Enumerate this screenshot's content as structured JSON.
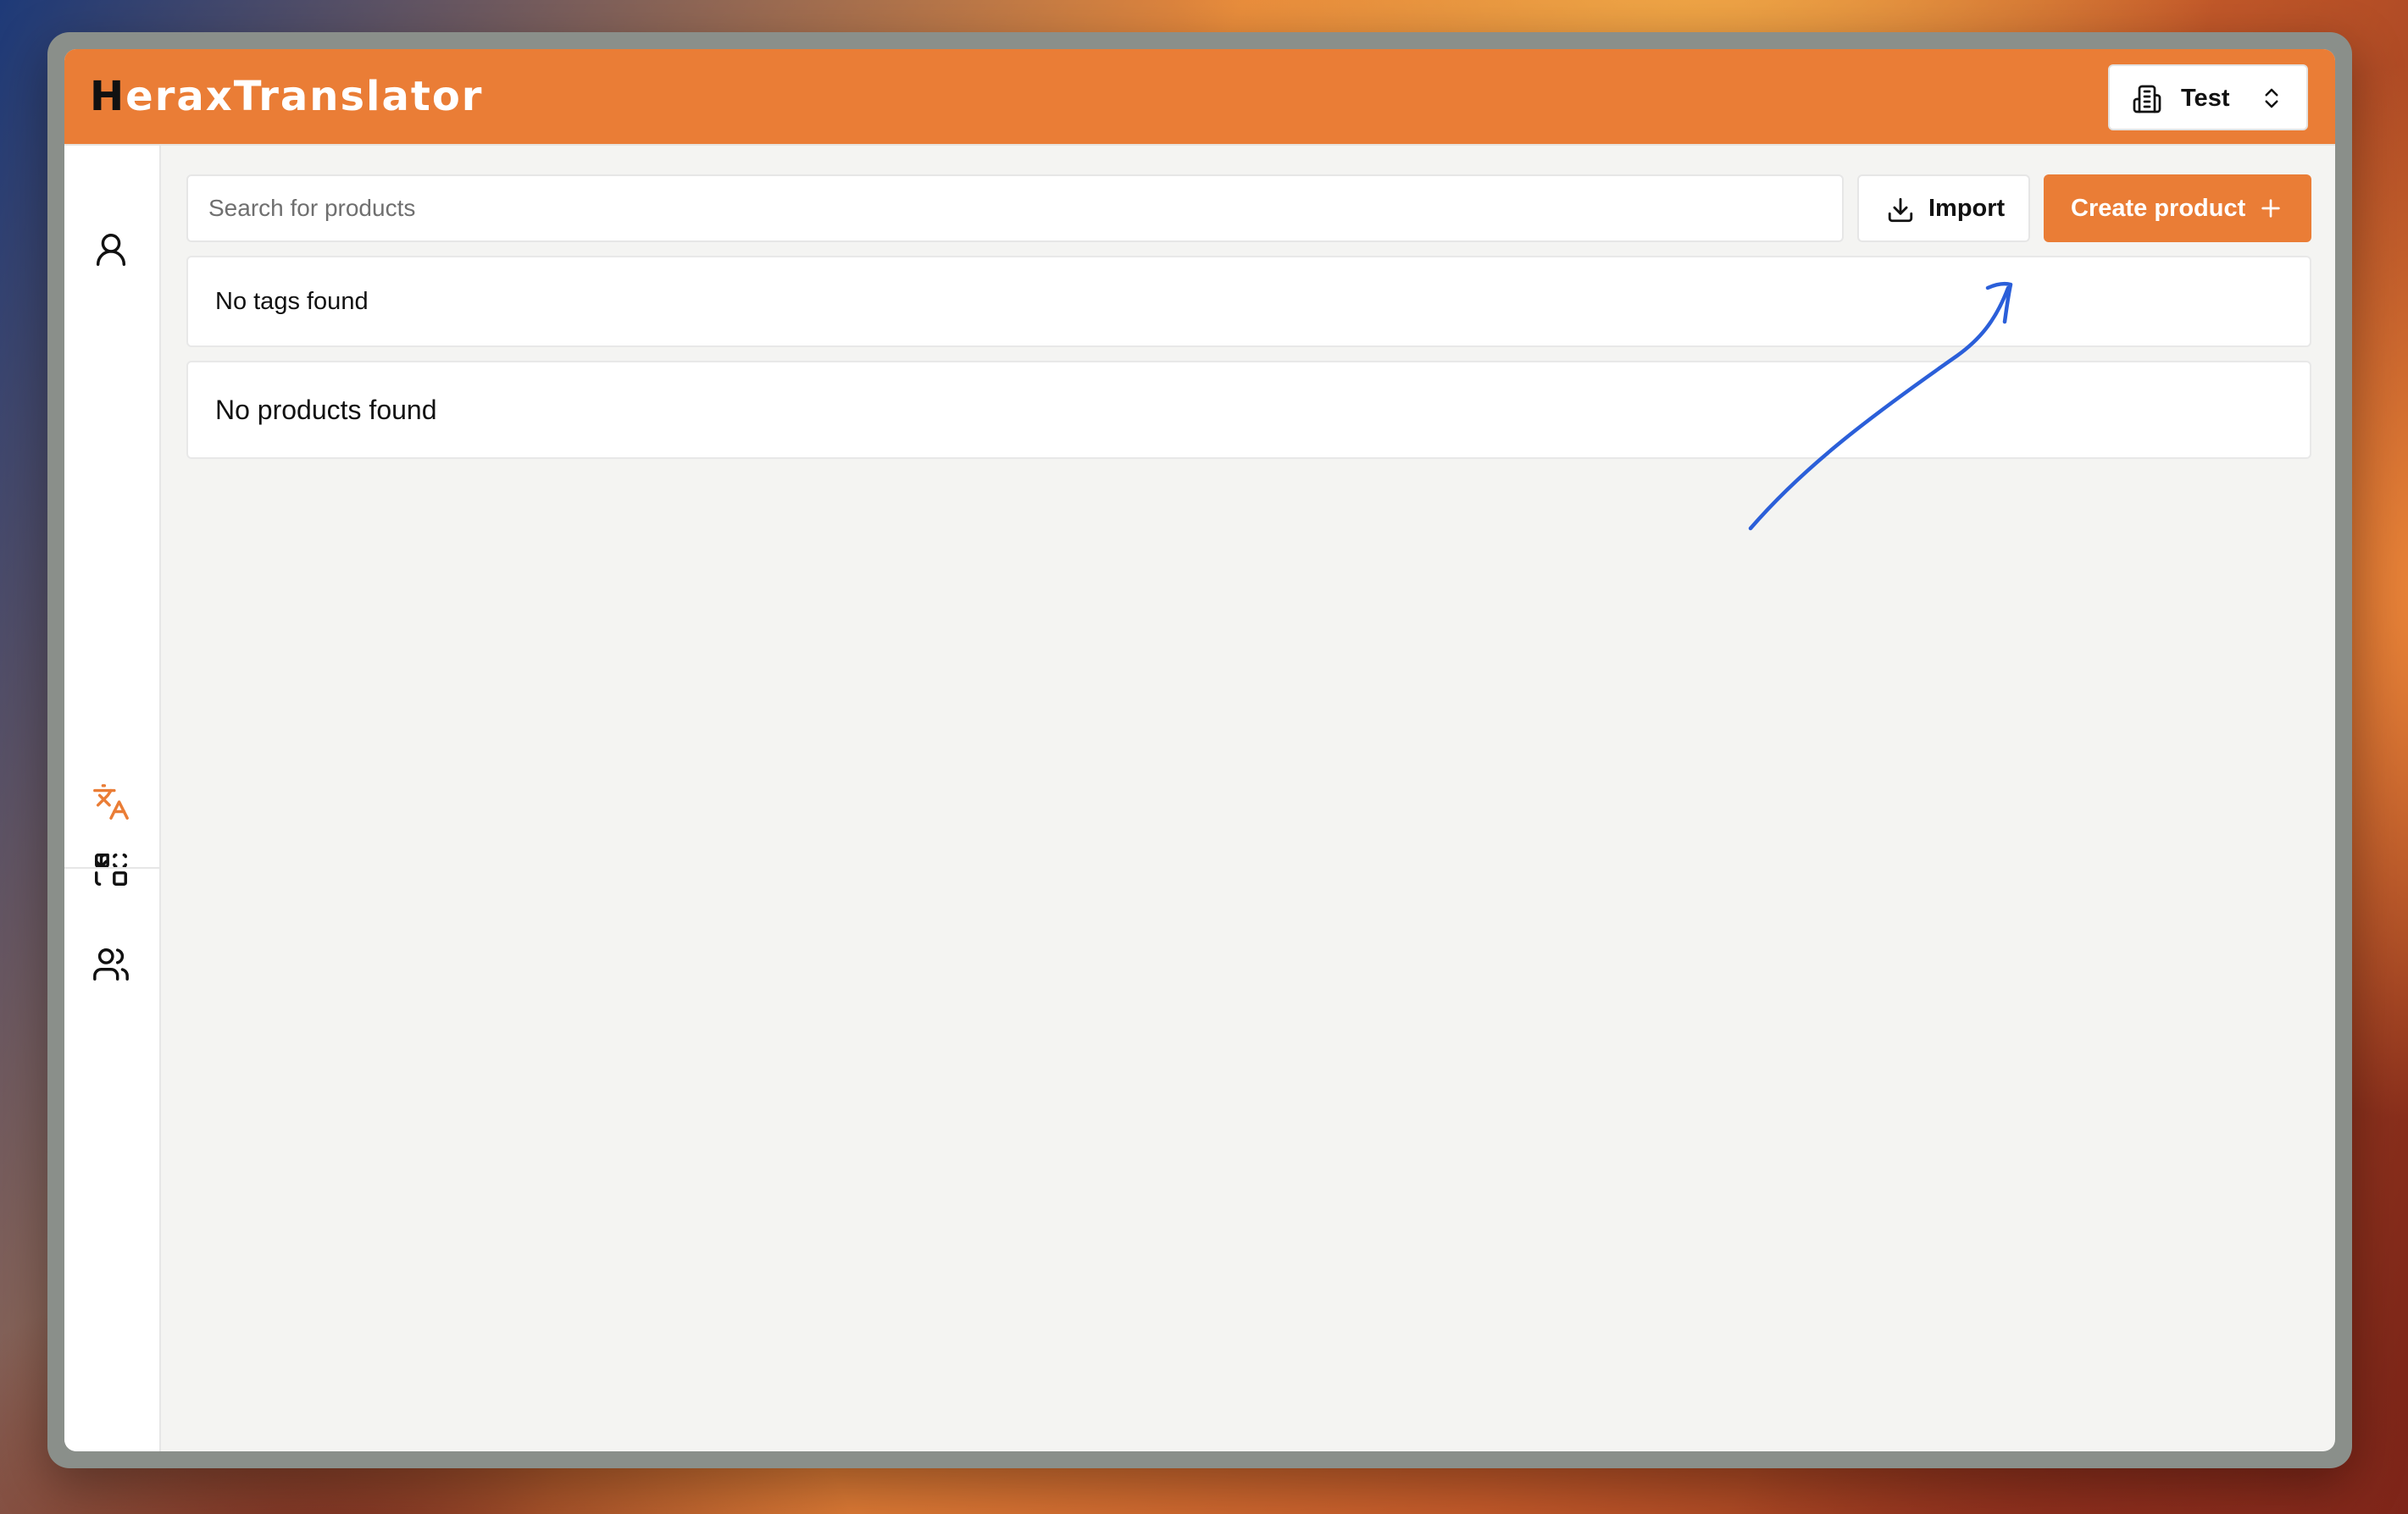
{
  "app": {
    "logo_mark": "H",
    "logo_rest": "eraxTranslator"
  },
  "org_selector": {
    "label": "Test",
    "icon": "building-icon",
    "chevron": "chevrons-up-down-icon"
  },
  "sidebar": {
    "items": [
      {
        "icon": "user-icon"
      },
      {
        "icon": "translate-icon"
      },
      {
        "icon": "layout-switch-icon"
      },
      {
        "icon": "users-icon"
      }
    ]
  },
  "toolbar": {
    "search_placeholder": "Search for products",
    "import_label": "Import",
    "create_label": "Create product"
  },
  "tags": {
    "empty_text": "No tags found"
  },
  "products": {
    "empty_text": "No products found"
  },
  "colors": {
    "accent": "#ea7d36",
    "annotation": "#2b5fd9"
  }
}
